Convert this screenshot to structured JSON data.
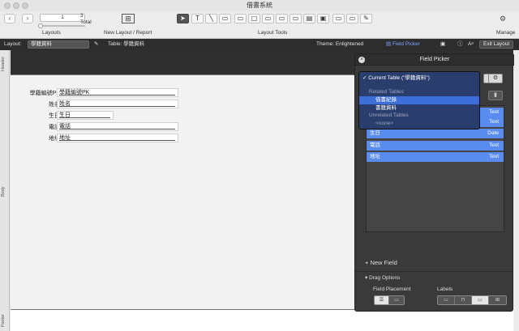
{
  "window": {
    "title": "借書系統"
  },
  "toolbar": {
    "record_number": "1",
    "record_total": "3",
    "total_label": "Total",
    "layouts_label": "Layouts",
    "new_layout_label": "New Layout / Report",
    "layout_tools_label": "Layout Tools",
    "manage_label": "Manage"
  },
  "layout_bar": {
    "layout_label": "Layout:",
    "layout_value": "學籍資料",
    "table_label": "Table: 學籍資料",
    "theme_label": "Theme: Enlightened",
    "field_picker_label": "Field Picker",
    "exit_label": "Exit Layout"
  },
  "parts": {
    "header": "Header",
    "body": "Body",
    "footer": "Footer"
  },
  "form": {
    "fields": [
      {
        "label": "學籍編號PK",
        "value": "學籍編號PK"
      },
      {
        "label": "姓名",
        "value": "姓名"
      },
      {
        "label": "生日",
        "value": "生日"
      },
      {
        "label": "電話",
        "value": "電話"
      },
      {
        "label": "地址",
        "value": "地址"
      }
    ]
  },
  "field_picker": {
    "title": "Field Picker",
    "dropdown": {
      "current": "✓ Current Table (\"學籍資料\")",
      "related_heading": "Related Tables",
      "related": [
        "借書紀錄",
        "書籍資料"
      ],
      "unrelated_heading": "Unrelated Tables",
      "unrelated_none": "<none>"
    },
    "fields": [
      {
        "name": "",
        "type": "Text"
      },
      {
        "name": "",
        "type": "Text"
      },
      {
        "name": "生日",
        "type": "Date"
      },
      {
        "name": "電話",
        "type": "Text"
      },
      {
        "name": "地址",
        "type": "Text"
      }
    ],
    "new_field": "+ New Field",
    "drag_options": "Drag Options",
    "field_placement": "Field Placement",
    "labels": "Labels"
  }
}
